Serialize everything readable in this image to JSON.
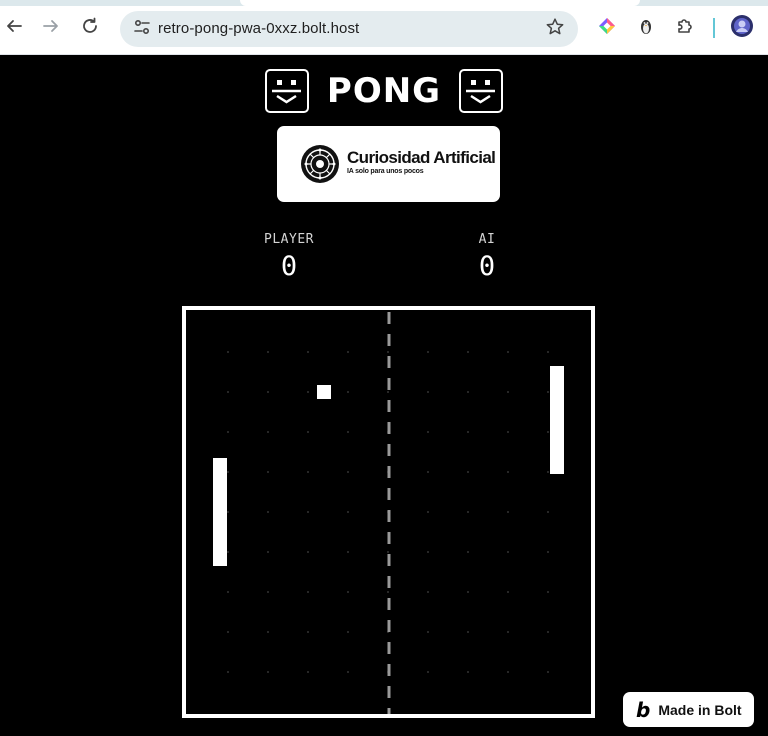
{
  "browser": {
    "url": "retro-pong-pwa-0xxz.bolt.host",
    "icons": {
      "back": "arrow-left-icon",
      "forward": "arrow-right-icon",
      "reload": "reload-icon",
      "site_info": "tune-icon",
      "bookmark": "star-icon",
      "extension_1": "colorful-diamond-icon",
      "extension_2": "penguin-icon",
      "extensions": "puzzle-icon",
      "profile": "avatar"
    }
  },
  "header": {
    "title": "PONG",
    "left_icon": "smiley-face-icon",
    "right_icon": "smiley-face-icon"
  },
  "sponsor": {
    "name": "Curiosidad Artificial",
    "tagline": "IA solo para unos pocos",
    "icon": "circuit-brain-icon"
  },
  "scoreboard": {
    "player_label": "PLAYER",
    "player_score": "0",
    "ai_label": "AI",
    "ai_score": "0"
  },
  "court": {
    "colors": {
      "background": "#000000",
      "lines": "#ffffff",
      "grid_dots": "#444444"
    }
  },
  "badge": {
    "label": "Made in Bolt",
    "icon": "bolt-b-icon"
  }
}
